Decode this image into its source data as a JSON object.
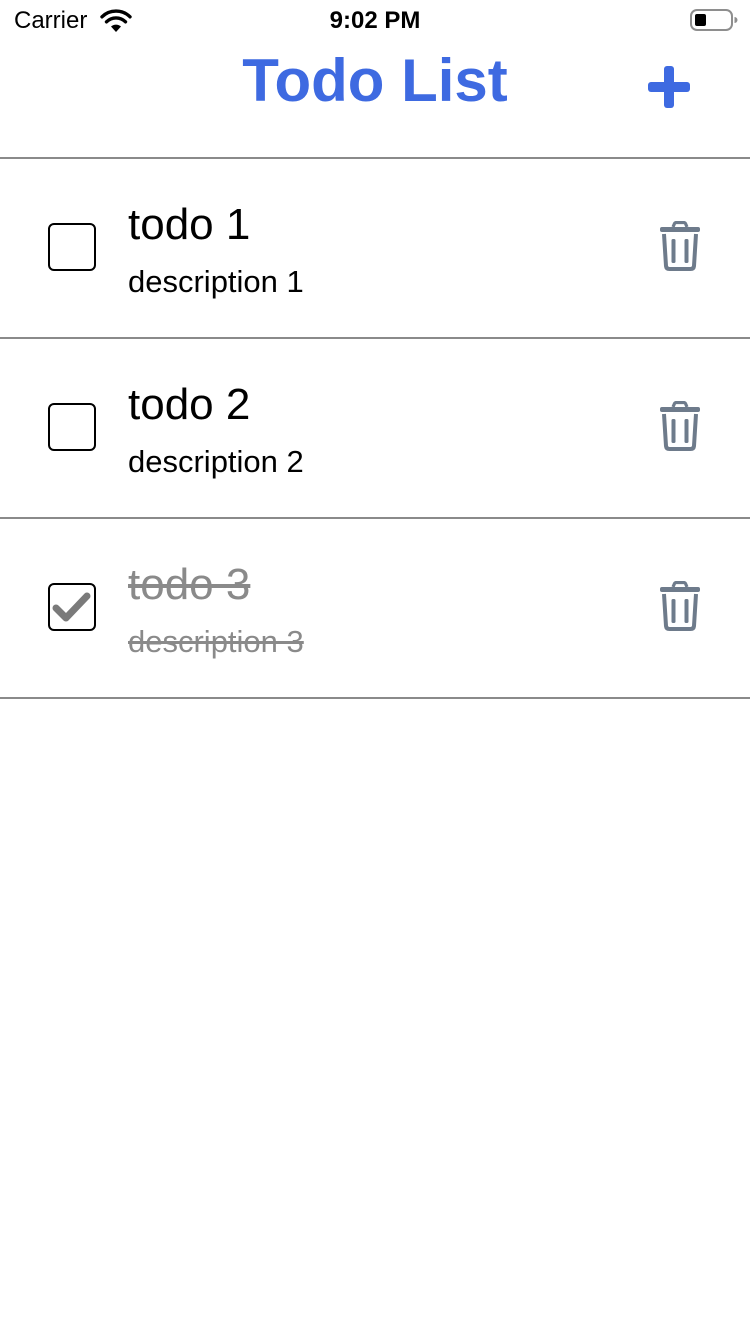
{
  "status_bar": {
    "carrier": "Carrier",
    "time": "9:02 PM",
    "wifi_icon": "wifi-icon",
    "battery_icon": "battery-icon"
  },
  "nav": {
    "title": "Todo List",
    "add_icon": "plus-icon",
    "accent_color": "#3e6ae1"
  },
  "todos": [
    {
      "title": "todo 1",
      "description": "description 1",
      "completed": false,
      "delete_icon": "trash-icon"
    },
    {
      "title": "todo 2",
      "description": "description 2",
      "completed": false,
      "delete_icon": "trash-icon"
    },
    {
      "title": "todo 3",
      "description": "description 3",
      "completed": true,
      "delete_icon": "trash-icon"
    }
  ],
  "colors": {
    "completed_text": "#8a8a8a",
    "icon_gray": "#6e7b8b",
    "divider": "#8a8a8a"
  }
}
